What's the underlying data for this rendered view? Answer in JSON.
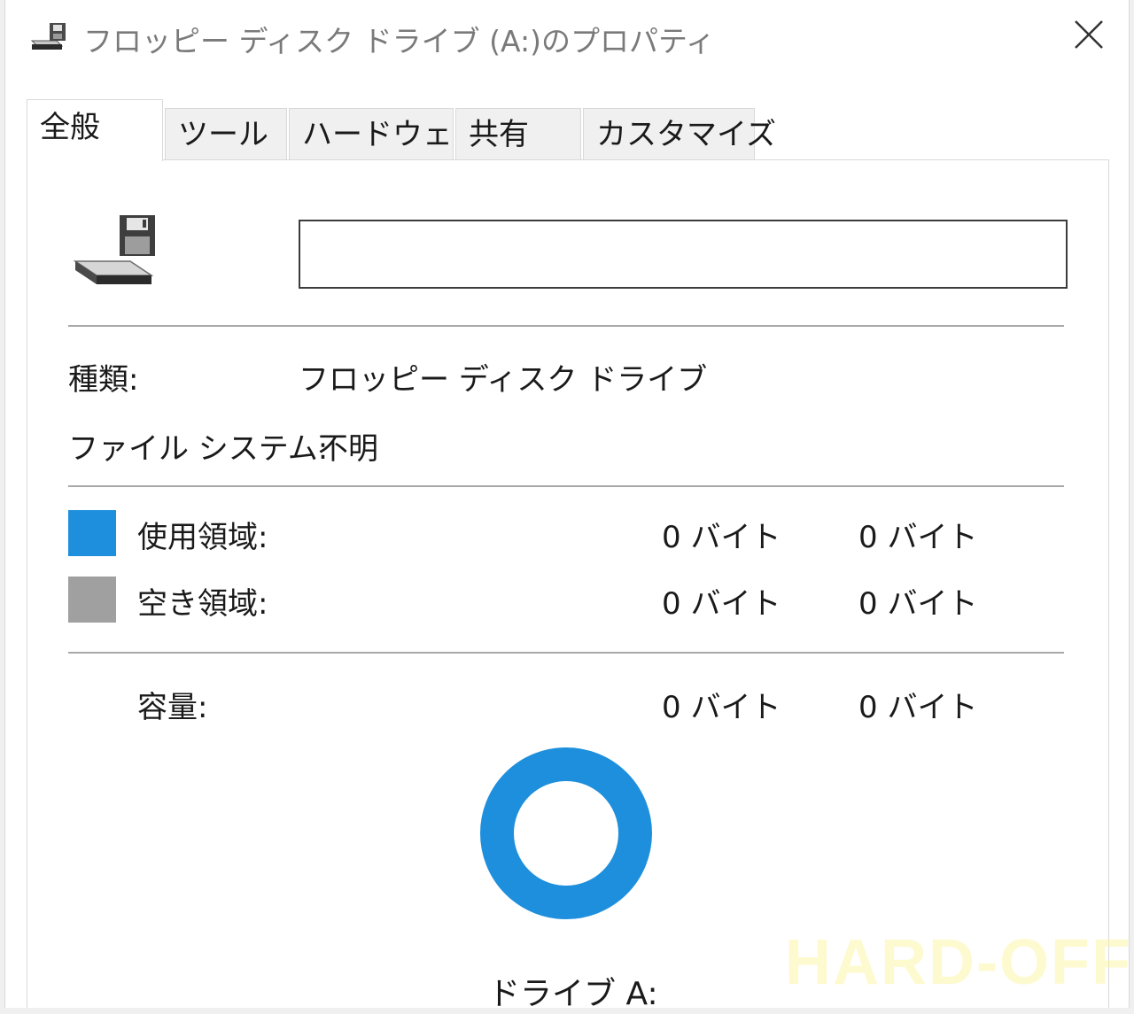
{
  "window": {
    "title": "フロッピー ディスク ドライブ (A:)のプロパティ",
    "title_icon": "floppy-drive-icon",
    "close_icon": "close-icon"
  },
  "tabs": [
    {
      "label": "全般",
      "active": true
    },
    {
      "label": "ツール",
      "active": false
    },
    {
      "label": "ハードウェア",
      "active": false
    },
    {
      "label": "共有",
      "active": false
    },
    {
      "label": "カスタマイズ",
      "active": false
    }
  ],
  "general": {
    "drive_icon": "floppy-drive-icon",
    "name_input_value": "",
    "type_label": "種類:",
    "type_value": "フロッピー ディスク ドライブ",
    "fs_label": "ファイル システム:",
    "fs_value": "不明",
    "used_label": "使用領域:",
    "used_bytes": "0 バイト",
    "used_size": "0 バイト",
    "free_label": "空き領域:",
    "free_bytes": "0 バイト",
    "free_size": "0 バイト",
    "capacity_label": "容量:",
    "capacity_bytes": "0 バイト",
    "capacity_size": "0 バイト",
    "drive_label": "ドライブ A:"
  },
  "colors": {
    "used": "#1e8fdc",
    "free": "#a0a0a0"
  },
  "watermark": "HARD-OFF"
}
